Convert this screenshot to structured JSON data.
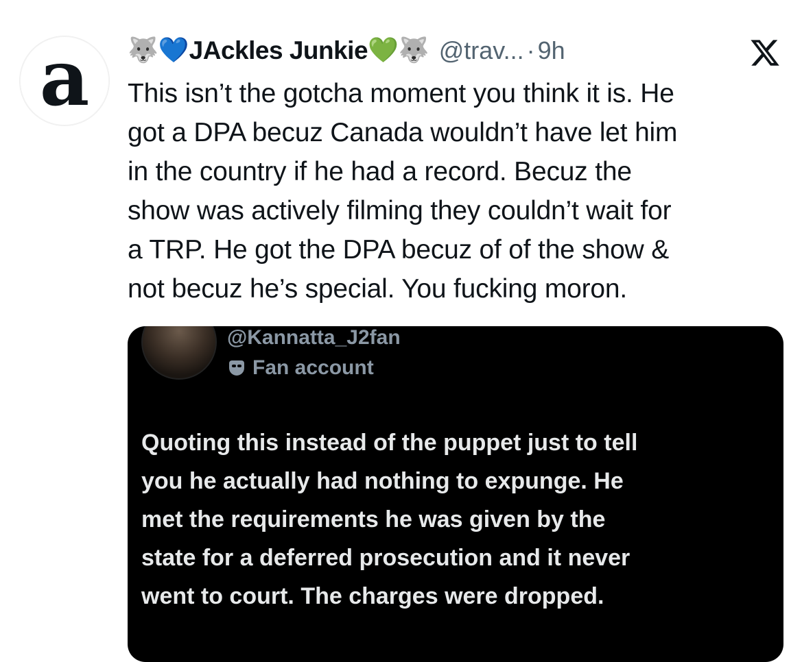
{
  "tweet": {
    "author": {
      "avatar_letter": "a",
      "name_prefix_emoji": "🐺",
      "name_heart_left": "💙",
      "display_name": "JAckles Junkie",
      "name_heart_right": "💚",
      "name_suffix_emoji": "🐺",
      "handle": "@trav...",
      "separator": "·",
      "time": "9h"
    },
    "platform_icon": "x-logo-icon",
    "text": "This isn’t the gotcha moment you think it is.  He\ngot a DPA becuz Canada wouldn’t have let him\nin the country if he had a record. Becuz the\nshow was actively filming they couldn’t wait for\na TRP. He got the DPA becuz of of the show &\nnot becuz he’s special.  You fucking moron."
  },
  "quoted_tweet": {
    "handle": "@Kannatta_J2fan",
    "label_icon": "mask-icon",
    "label": "Fan account",
    "text": "Quoting this instead of the puppet just to tell\nyou he actually had nothing to expunge. He\nmet the requirements he was given by the\nstate for a deferred prosecution and it never\nwent to court. The charges were dropped."
  },
  "colors": {
    "text_primary": "#0f1419",
    "text_secondary": "#536471",
    "quote_background": "#000000",
    "quote_text": "#e7e9ea",
    "quote_meta": "#8b98a5",
    "heart_blue": "#1d6ff2",
    "heart_green": "#2fbf3c"
  }
}
